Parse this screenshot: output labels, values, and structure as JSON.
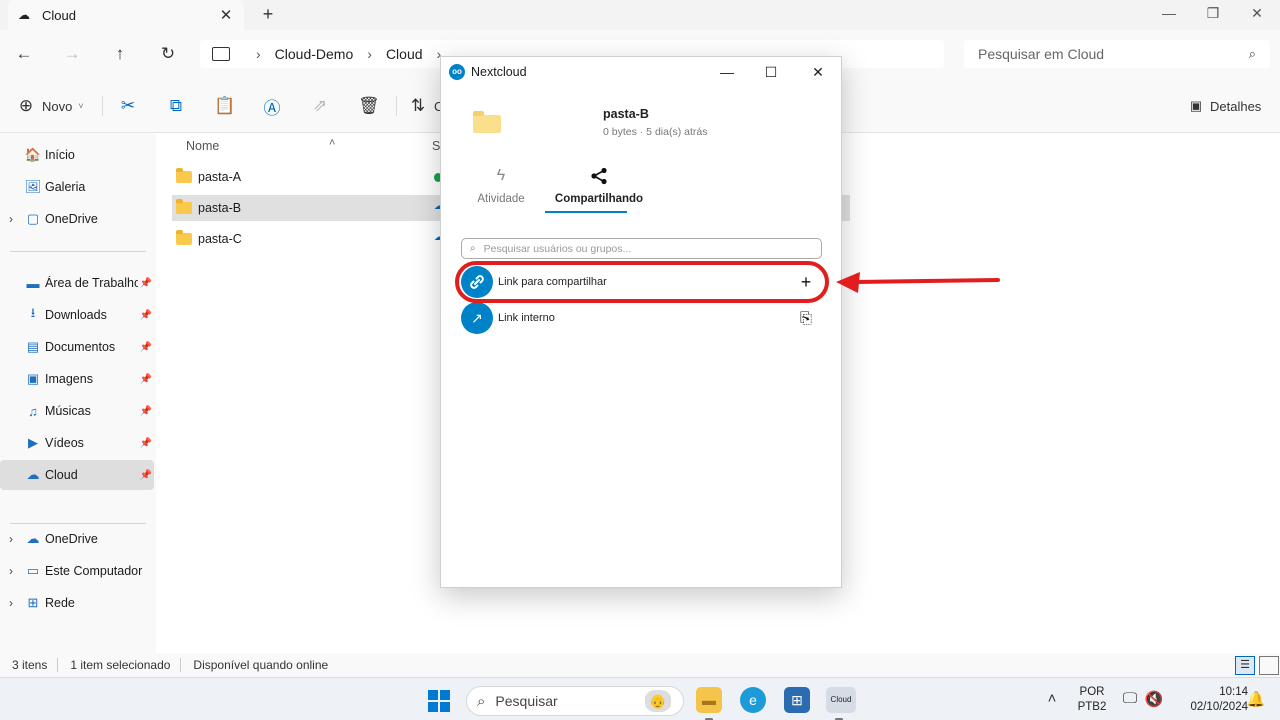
{
  "window": {
    "tab_title": "Cloud",
    "tab_icon": "cloud-nc-icon",
    "new_tab": "+",
    "minimize": "—",
    "maximize": "❐",
    "close": "✕"
  },
  "address": {
    "crumbs": [
      "Cloud-Demo",
      "Cloud"
    ],
    "search_placeholder": "Pesquisar em Cloud"
  },
  "commands": {
    "new_label": "Novo",
    "sort_label": "C",
    "details_label": "Detalhes"
  },
  "sidebar": {
    "items": [
      {
        "label": "Início",
        "icon": "home-icon",
        "glyph": "🏠",
        "pinned": false,
        "chevron": false
      },
      {
        "label": "Galeria",
        "icon": "gallery-icon",
        "glyph": "🖼",
        "pinned": false,
        "chevron": false
      },
      {
        "label": "OneDrive",
        "icon": "onedrive-folder-icon",
        "glyph": "▢",
        "pinned": false,
        "chevron": true
      },
      {
        "label": "Área de Trabalho",
        "icon": "desktop-icon",
        "glyph": "▬",
        "pinned": true,
        "chevron": false
      },
      {
        "label": "Downloads",
        "icon": "downloads-icon",
        "glyph": "⭳",
        "pinned": true,
        "chevron": false
      },
      {
        "label": "Documentos",
        "icon": "documents-icon",
        "glyph": "▤",
        "pinned": true,
        "chevron": false
      },
      {
        "label": "Imagens",
        "icon": "images-icon",
        "glyph": "▣",
        "pinned": true,
        "chevron": false
      },
      {
        "label": "Músicas",
        "icon": "music-icon",
        "glyph": "♫",
        "pinned": true,
        "chevron": false
      },
      {
        "label": "Vídeos",
        "icon": "videos-icon",
        "glyph": "▶",
        "pinned": true,
        "chevron": false
      },
      {
        "label": "Cloud",
        "icon": "cloud-nc-icon",
        "glyph": "☁",
        "pinned": true,
        "chevron": false
      },
      {
        "label": "OneDrive",
        "icon": "onedrive-icon",
        "glyph": "☁",
        "pinned": false,
        "chevron": true
      },
      {
        "label": "Este Computador",
        "icon": "computer-icon",
        "glyph": "▭",
        "pinned": false,
        "chevron": true
      },
      {
        "label": "Rede",
        "icon": "network-icon",
        "glyph": "⊞",
        "pinned": false,
        "chevron": true
      }
    ]
  },
  "files": {
    "column_name": "Nome",
    "column_status": "S",
    "rows": [
      {
        "name": "pasta-A",
        "status": "synced"
      },
      {
        "name": "pasta-B",
        "status": "online"
      },
      {
        "name": "pasta-C",
        "status": "online"
      }
    ]
  },
  "statusbar": {
    "count": "3 itens",
    "selected": "1 item selecionado",
    "availability": "Disponível quando online"
  },
  "popup": {
    "title": "Nextcloud",
    "logo": "oo",
    "file_name": "pasta-B",
    "file_meta": "0 bytes · 5 dia(s) atrás",
    "tabs": [
      {
        "label": "Atividade",
        "icon": "activity-icon",
        "glyph": "ϟ"
      },
      {
        "label": "Compartilhando",
        "icon": "share-icon",
        "glyph": "⋘"
      }
    ],
    "active_tab": "Compartilhando",
    "search_placeholder": "Pesquisar usuários ou grupos...",
    "share_rows": [
      {
        "label": "Link para compartilhar",
        "icon": "link-icon",
        "glyph": "🔗",
        "action": "+",
        "action_icon": "add-icon"
      },
      {
        "label": "Link interno",
        "icon": "external-link-icon",
        "glyph": "↗",
        "action": "⎘",
        "action_icon": "copy-icon"
      }
    ]
  },
  "annotation": {
    "color": "#e11d1d"
  },
  "taskbar": {
    "search_placeholder": "Pesquisar",
    "language": "POR",
    "layout": "PTB2",
    "time": "10:14",
    "date": "02/10/2024",
    "cloud_app_label": "Cloud"
  },
  "colors": {
    "accent": "#0078d4",
    "nextcloud_blue": "#0082c9",
    "folder_yellow": "#f8c94b"
  }
}
